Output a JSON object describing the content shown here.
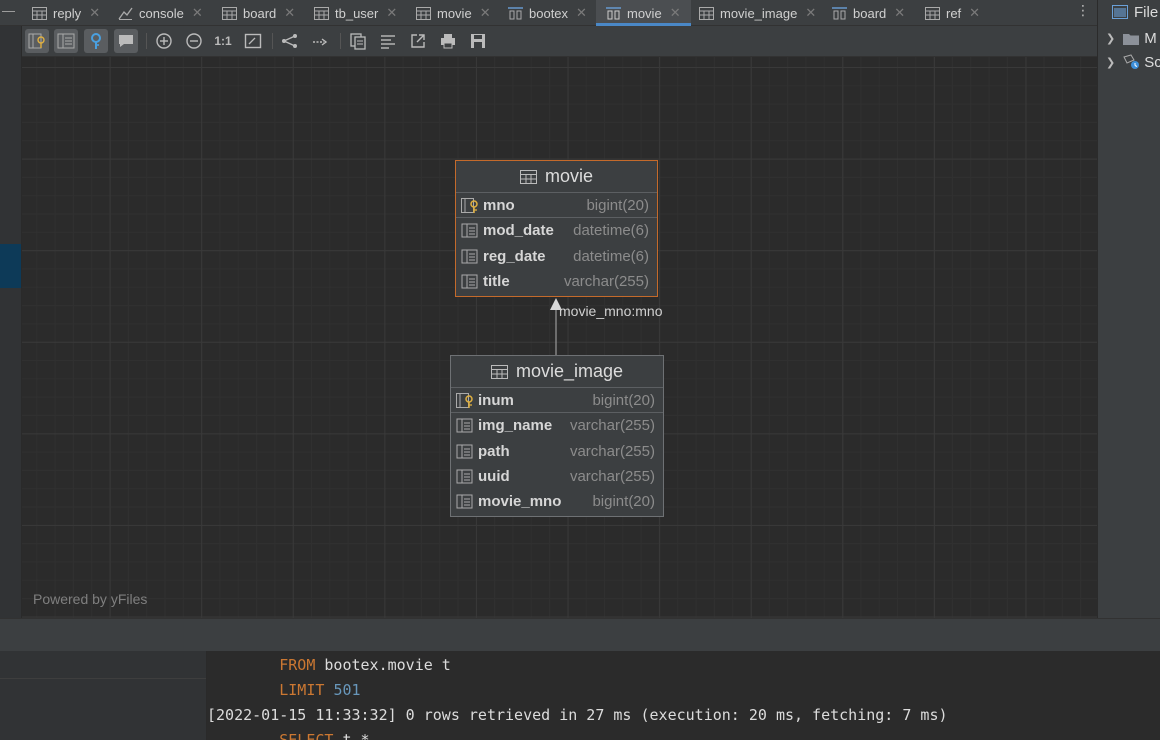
{
  "tabs": [
    {
      "label": "reply",
      "icon": "table-icon",
      "active": false
    },
    {
      "label": "console",
      "icon": "console-icon",
      "active": false
    },
    {
      "label": "board",
      "icon": "table-icon",
      "active": false
    },
    {
      "label": "tb_user",
      "icon": "table-icon",
      "active": false
    },
    {
      "label": "movie",
      "icon": "table-icon",
      "active": false
    },
    {
      "label": "bootex",
      "icon": "diagram-icon",
      "active": false
    },
    {
      "label": "movie",
      "icon": "diagram-icon",
      "active": true
    },
    {
      "label": "movie_image",
      "icon": "table-icon",
      "active": false
    },
    {
      "label": "board",
      "icon": "diagram-icon",
      "active": false
    },
    {
      "label": "ref",
      "icon": "table-icon",
      "active": false
    }
  ],
  "toolbar": {
    "zoom_actual_label": "1:1"
  },
  "diagram": {
    "edge_label": "movie_mno:mno",
    "powered_by": "Powered by yFiles",
    "movie": {
      "title": "movie",
      "columns": [
        {
          "name": "mno",
          "type": "bigint(20)",
          "pk": true
        },
        {
          "name": "mod_date",
          "type": "datetime(6)",
          "pk": false
        },
        {
          "name": "reg_date",
          "type": "datetime(6)",
          "pk": false
        },
        {
          "name": "title",
          "type": "varchar(255)",
          "pk": false
        }
      ]
    },
    "movie_image": {
      "title": "movie_image",
      "columns": [
        {
          "name": "inum",
          "type": "bigint(20)",
          "pk": true
        },
        {
          "name": "img_name",
          "type": "varchar(255)",
          "pk": false
        },
        {
          "name": "path",
          "type": "varchar(255)",
          "pk": false
        },
        {
          "name": "uuid",
          "type": "varchar(255)",
          "pk": false
        },
        {
          "name": "movie_mno",
          "type": "bigint(20)",
          "pk": false
        }
      ]
    }
  },
  "right_panel": {
    "title": "File",
    "item1": "M",
    "item2": "Sc"
  },
  "console": {
    "line1_kw": "FROM",
    "line1_rest": " bootex.movie t",
    "line2_kw": "LIMIT",
    "line2_num": "501",
    "line3": "[2022-01-15 11:33:32] 0 rows retrieved in 27 ms (execution: 20 ms, fetching: 7 ms)",
    "line4_kw": "SELECT",
    "line4_rest": " t.*"
  }
}
